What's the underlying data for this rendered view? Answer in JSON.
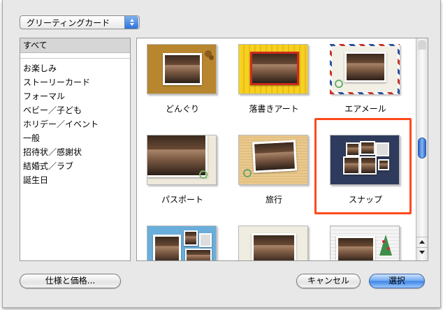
{
  "popup": {
    "selected": "グリーティングカード"
  },
  "categories": {
    "all": "すべて",
    "items": [
      "お楽しみ",
      "ストーリーカード",
      "フォーマル",
      "ベビー／子ども",
      "ホリデー／イベント",
      "一般",
      "招待状／感謝状",
      "結婚式／ラブ",
      "誕生日"
    ]
  },
  "cards": [
    {
      "label": "どんぐり",
      "style": "acorn"
    },
    {
      "label": "落書きアート",
      "style": "doodle"
    },
    {
      "label": "エアメール",
      "style": "airmail"
    },
    {
      "label": "パスポート",
      "style": "passport"
    },
    {
      "label": "旅行",
      "style": "travel"
    },
    {
      "label": "スナップ",
      "style": "snap",
      "selected": true
    },
    {
      "label": "",
      "style": "blue-snap"
    },
    {
      "label": "",
      "style": "plain"
    },
    {
      "label": "",
      "style": "holiday"
    }
  ],
  "buttons": {
    "specs": "仕様と価格...",
    "cancel": "キャンセル",
    "select": "選択"
  },
  "colors": {
    "selection_ring": "#ff4a1c",
    "default_button": "#3c84e6"
  }
}
